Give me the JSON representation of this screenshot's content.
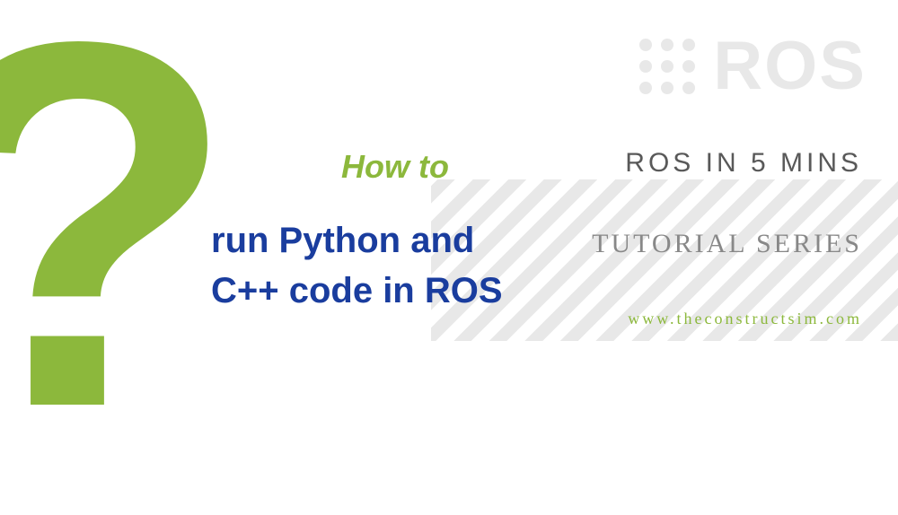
{
  "question_mark": "?",
  "ros_logo_text": "ROS",
  "how_to_label": "How to",
  "main_title_line1": "run Python and",
  "main_title_line2": "C++ code in ROS",
  "ros_in_5_label": "ROS IN 5 MINS",
  "tutorial_series_label": "TUTORIAL SERIES",
  "website_url": "www.theconstructsim.com"
}
